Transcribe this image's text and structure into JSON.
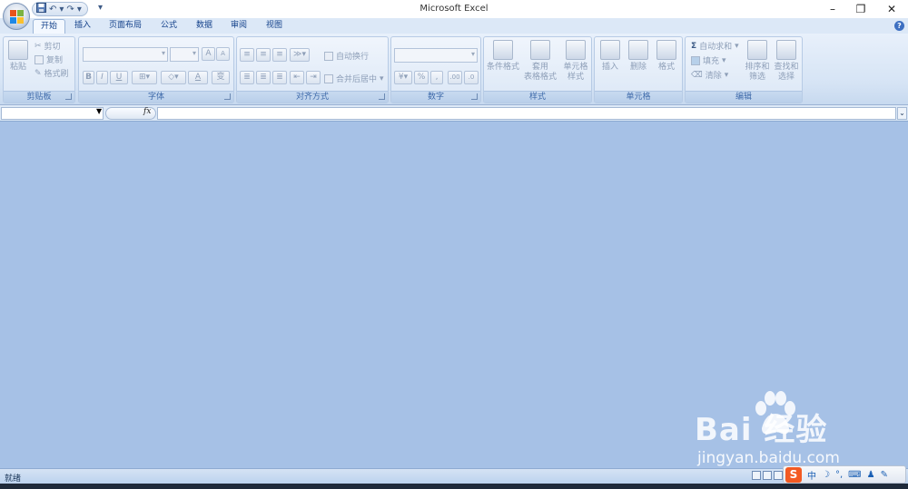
{
  "window": {
    "title": "Microsoft Excel",
    "minimize_glyph": "–",
    "restore_glyph": "❐",
    "close_glyph": "✕"
  },
  "qat": {
    "save_icon": "save-icon",
    "undo_glyph": "↶",
    "redo_glyph": "↷",
    "more_glyph": "▾"
  },
  "tabs": [
    {
      "label": "开始",
      "active": true
    },
    {
      "label": "插入"
    },
    {
      "label": "页面布局"
    },
    {
      "label": "公式"
    },
    {
      "label": "数据"
    },
    {
      "label": "审阅"
    },
    {
      "label": "视图"
    }
  ],
  "ribbon": {
    "clipboard": {
      "label": "剪贴板",
      "paste": "粘贴",
      "cut": "剪切",
      "copy": "复制",
      "format_painter": "格式刷"
    },
    "font": {
      "label": "字体",
      "grow": "A",
      "shrink": "A",
      "bold": "B",
      "italic": "I",
      "underline": "U",
      "font_color": "A",
      "phonetic": "变"
    },
    "alignment": {
      "label": "对齐方式",
      "wrap_text": "自动换行",
      "merge_center": "合并后居中"
    },
    "number": {
      "label": "数字",
      "percent": "%",
      "comma": ",",
      "inc_decimal": ".00",
      "dec_decimal": ".0"
    },
    "styles": {
      "label": "样式",
      "conditional": "条件格式",
      "table_format_1": "套用",
      "table_format_2": "表格格式",
      "cell_styles_1": "单元格",
      "cell_styles_2": "样式"
    },
    "cells": {
      "label": "单元格",
      "insert": "插入",
      "delete": "删除",
      "format": "格式"
    },
    "editing": {
      "label": "编辑",
      "autosum": "自动求和",
      "fill": "填充",
      "clear": "清除",
      "sort_1": "排序和",
      "sort_2": "筛选",
      "find_1": "查找和",
      "find_2": "选择"
    }
  },
  "formula_bar": {
    "fx": "fx"
  },
  "status": {
    "text": "就绪"
  },
  "watermark": {
    "main": "Bai  经验",
    "sub": "jingyan.baidu.com"
  },
  "ime": {
    "logo": "S",
    "lang": "中"
  },
  "colors": {
    "workspace": "#a6c1e6",
    "ribbon_top": "#e8f0fb",
    "accent": "#15428b"
  }
}
